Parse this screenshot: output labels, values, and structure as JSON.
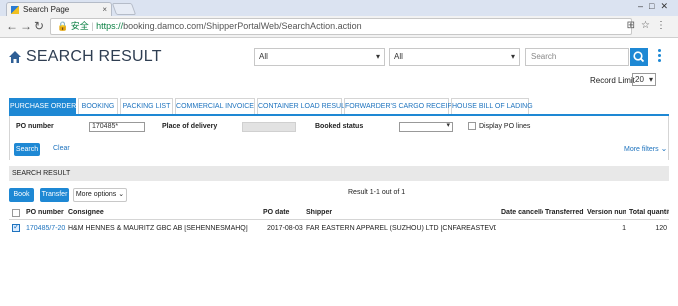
{
  "browser": {
    "tab_title": "Search Page",
    "tab_close": "×",
    "secure_label": "安全",
    "url_proto": "https://",
    "url_rest": "booking.damco.com/ShipperPortalWeb/SearchAction.action"
  },
  "header": {
    "title": "SEARCH RESULT",
    "select1_value": "All",
    "select2_value": "All",
    "search_placeholder": "Search",
    "record_limit_label": "Record Limit",
    "record_limit_value": "20"
  },
  "tabs": [
    {
      "label": "PURCHASE ORDER",
      "active": true
    },
    {
      "label": "BOOKING",
      "active": false
    },
    {
      "label": "PACKING LIST",
      "active": false
    },
    {
      "label": "COMMERCIAL INVOICE",
      "active": false
    },
    {
      "label": "CONTAINER LOAD RESULT",
      "active": false
    },
    {
      "label": "FORWARDER'S CARGO RECEIPT",
      "active": false
    },
    {
      "label": "HOUSE BILL OF LADING",
      "active": false
    }
  ],
  "filters": {
    "po_number_label": "PO number",
    "po_number_value": "170485*",
    "place_of_delivery_label": "Place of delivery",
    "booked_status_label": "Booked status",
    "display_po_lines_label": "Display PO lines",
    "search_button": "Search",
    "clear_link": "Clear",
    "more_filters_link": "More filters"
  },
  "results": {
    "section_title": "SEARCH RESULT",
    "book_button": "Book",
    "transfer_button": "Transfer",
    "more_options_button": "More options",
    "result_text": "Result 1-1 out of 1",
    "columns": [
      "PO number",
      "Consignee",
      "PO date",
      "Shipper",
      "Date cancelled",
      "Transferred F",
      "Version number",
      "Total quantity"
    ],
    "rows": [
      {
        "checked": true,
        "po_number": "170485/7-201",
        "consignee": "H&M HENNES & MAURITZ GBC AB [SEHENNESMAHQ]",
        "po_date": "2017-08-03",
        "shipper": "FAR EASTERN APPAREL (SUZHOU) LTD [CNFAREASTEVDR]",
        "date_cancelled": "",
        "transferred": "",
        "version": "1",
        "total_quantity": "120"
      }
    ]
  },
  "colors": {
    "accent": "#1e88d4",
    "link": "#1e73be",
    "title": "#2f3e52"
  }
}
